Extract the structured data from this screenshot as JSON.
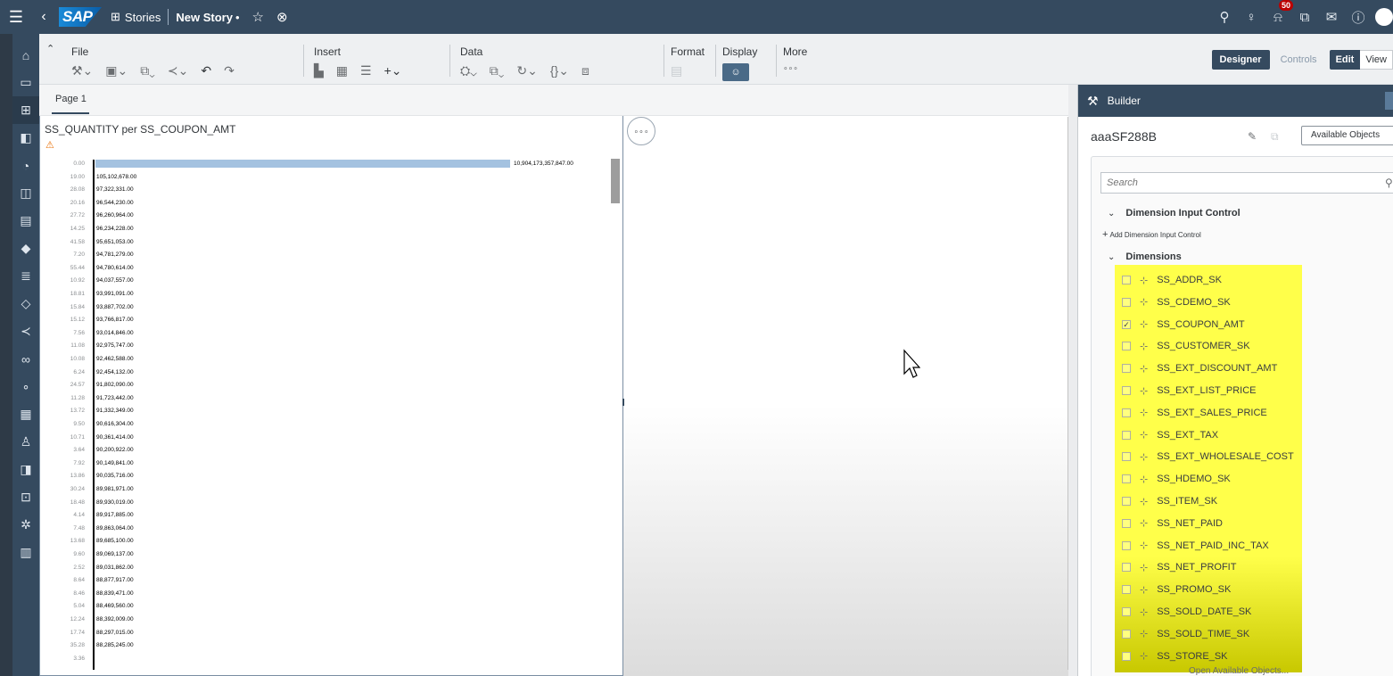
{
  "shell": {
    "logo": "SAP",
    "app": "Stories",
    "story_title": "New Story",
    "unsaved_mark": "•",
    "notification_count": "50"
  },
  "toolbar": {
    "file": "File",
    "insert": "Insert",
    "data": "Data",
    "format": "Format",
    "display": "Display",
    "more": "More",
    "more_dots": "∘∘∘",
    "designer": "Designer",
    "controls": "Controls",
    "edit": "Edit",
    "view": "View"
  },
  "canvas": {
    "page_tab": "Page 1"
  },
  "tile": {
    "title": "SS_QUANTITY per SS_COUPON_AMT",
    "more_button": "∘∘∘"
  },
  "chart_data": {
    "type": "bar",
    "orientation": "horizontal",
    "title": "SS_QUANTITY per SS_COUPON_AMT",
    "categories": [
      "0.00",
      "19.00",
      "28.08",
      "20.16",
      "27.72",
      "14.25",
      "41.58",
      "7.20",
      "55.44",
      "10.92",
      "18.81",
      "15.84",
      "15.12",
      "7.56",
      "11.08",
      "10.08",
      "6.24",
      "24.57",
      "11.28",
      "13.72",
      "9.50",
      "10.71",
      "3.64",
      "7.92",
      "13.86",
      "30.24",
      "18.48",
      "4.14",
      "7.48",
      "13.68",
      "9.60",
      "2.52",
      "8.64",
      "8.46",
      "5.04",
      "12.24",
      "17.74",
      "35.28",
      "3.36"
    ],
    "values": [
      10904173357847.0,
      105102678.0,
      97322331.0,
      96544230.0,
      96260964.0,
      96234228.0,
      95651053.0,
      94781279.0,
      94780614.0,
      94037557.0,
      93991091.0,
      93887702.0,
      93766817.0,
      93014846.0,
      92975747.0,
      92462588.0,
      92454132.0,
      91802090.0,
      91723442.0,
      91332349.0,
      90616304.0,
      90361414.0,
      90200922.0,
      90149841.0,
      90035716.0,
      89981971.0,
      89930019.0,
      89917885.0,
      89863064.0,
      89685100.0,
      89069137.0,
      89031862.0,
      88877917.0,
      88839471.0,
      88469560.0,
      88392009.0,
      88297015.0,
      88285245.0,
      null
    ],
    "value_labels": [
      "10,904,173,357,847.00",
      "105,102,678.00",
      "97,322,331.00",
      "96,544,230.00",
      "96,260,964.00",
      "96,234,228.00",
      "95,651,053.00",
      "94,781,279.00",
      "94,780,614.00",
      "94,037,557.00",
      "93,991,091.00",
      "93,887,702.00",
      "93,766,817.00",
      "93,014,846.00",
      "92,975,747.00",
      "92,462,588.00",
      "92,454,132.00",
      "91,802,090.00",
      "91,723,442.00",
      "91,332,349.00",
      "90,616,304.00",
      "90,361,414.00",
      "90,200,922.00",
      "90,149,841.00",
      "90,035,716.00",
      "89,981,971.00",
      "89,930,019.00",
      "89,917,885.00",
      "89,863,064.00",
      "89,685,100.00",
      "89,069,137.00",
      "89,031,862.00",
      "88,877,917.00",
      "88,839,471.00",
      "88,469,560.00",
      "88,392,009.00",
      "88,297,015.00",
      "88,285,245.00",
      ""
    ],
    "bar_color": "#a4c2e0"
  },
  "builder": {
    "title": "Builder",
    "model": "aaaSF288B",
    "available_objects": "Available Objects",
    "search_placeholder": "Search",
    "dic_section": "Dimension Input Control",
    "add_dic": "Add Dimension Input Control",
    "dims_section": "Dimensions",
    "dimensions": [
      {
        "name": "SS_ADDR_SK",
        "checked": false
      },
      {
        "name": "SS_CDEMO_SK",
        "checked": false
      },
      {
        "name": "SS_COUPON_AMT",
        "checked": true
      },
      {
        "name": "SS_CUSTOMER_SK",
        "checked": false
      },
      {
        "name": "SS_EXT_DISCOUNT_AMT",
        "checked": false
      },
      {
        "name": "SS_EXT_LIST_PRICE",
        "checked": false
      },
      {
        "name": "SS_EXT_SALES_PRICE",
        "checked": false
      },
      {
        "name": "SS_EXT_TAX",
        "checked": false
      },
      {
        "name": "SS_EXT_WHOLESALE_COST",
        "checked": false
      },
      {
        "name": "SS_HDEMO_SK",
        "checked": false
      },
      {
        "name": "SS_ITEM_SK",
        "checked": false
      },
      {
        "name": "SS_NET_PAID",
        "checked": false
      },
      {
        "name": "SS_NET_PAID_INC_TAX",
        "checked": false
      },
      {
        "name": "SS_NET_PROFIT",
        "checked": false
      },
      {
        "name": "SS_PROMO_SK",
        "checked": false
      },
      {
        "name": "SS_SOLD_DATE_SK",
        "checked": false
      },
      {
        "name": "SS_SOLD_TIME_SK",
        "checked": false
      },
      {
        "name": "SS_STORE_SK",
        "checked": false
      }
    ],
    "highlight_color": "#ffff4a",
    "footer_link": "Open Available Objects..."
  }
}
